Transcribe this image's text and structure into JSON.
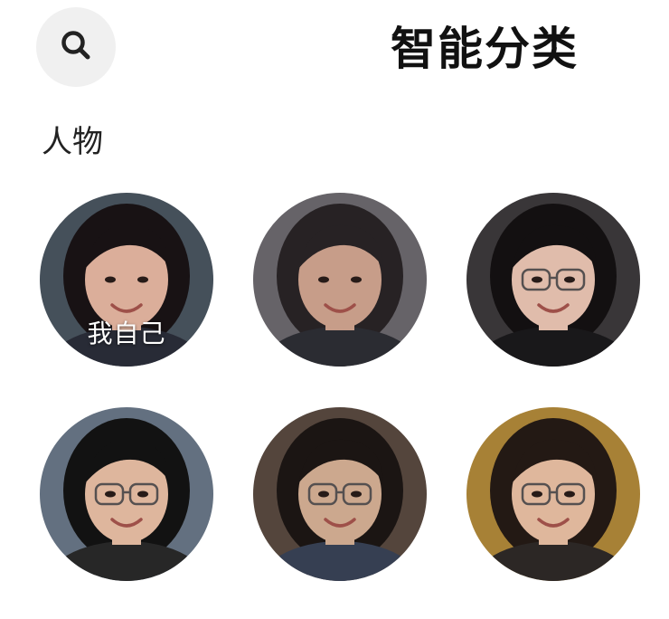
{
  "header": {
    "title": "智能分类",
    "search_icon": "search-icon"
  },
  "section": {
    "title": "人物"
  },
  "people": [
    {
      "label": "我自己",
      "bg": "#4a5560",
      "hair": "#1a1416",
      "skin": "#e9b9a4",
      "shirt": "#2b2e3a",
      "glasses": false
    },
    {
      "label": "",
      "bg": "#6d6a6f",
      "hair": "#2a2527",
      "skin": "#d4a792",
      "shirt": "#2e2f36",
      "glasses": false
    },
    {
      "label": "",
      "bg": "#3d3a3c",
      "hair": "#151213",
      "skin": "#efc8b6",
      "shirt": "#1b1a1c",
      "glasses": true
    },
    {
      "label": "",
      "bg": "#6a7888",
      "hair": "#141414",
      "skin": "#ecc2a7",
      "shirt": "#2a2a2a",
      "glasses": true
    },
    {
      "label": "",
      "bg": "#5a4a40",
      "hair": "#1d1715",
      "skin": "#d9b397",
      "shirt": "#3a4358",
      "glasses": true
    },
    {
      "label": "",
      "bg": "#b28a3a",
      "hair": "#261b16",
      "skin": "#edc3a6",
      "shirt": "#2f2a28",
      "glasses": true
    }
  ]
}
